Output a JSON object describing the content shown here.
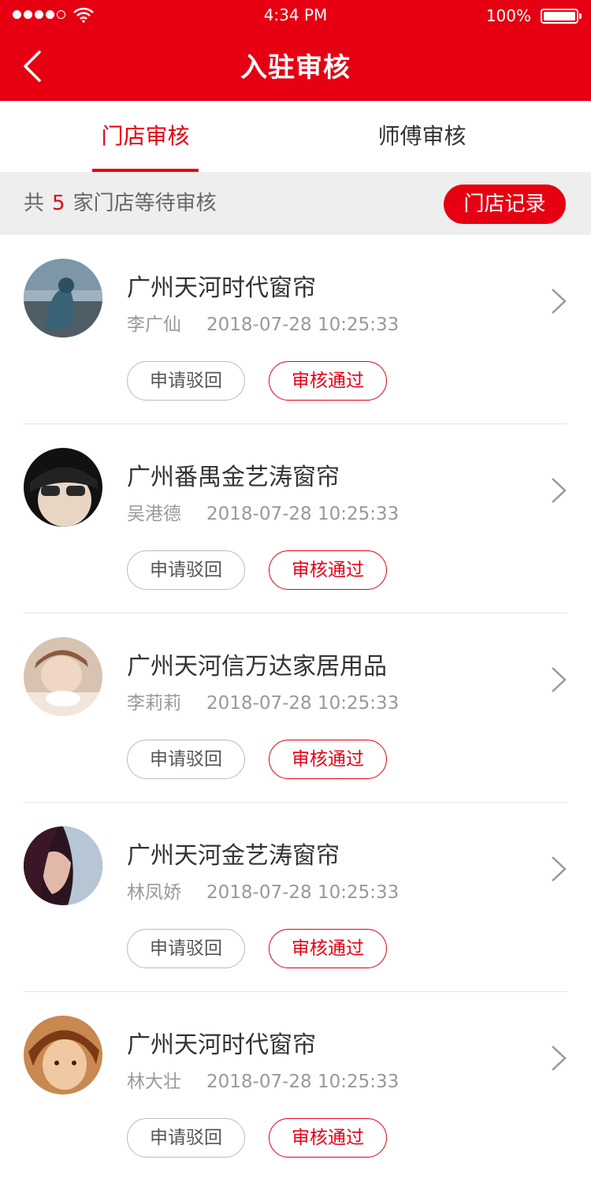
{
  "status_bar": {
    "time": "4:34 PM",
    "battery": "100%"
  },
  "nav": {
    "title": "入驻审核",
    "back_icon": "chevron-left-icon"
  },
  "tabs": [
    {
      "label": "门店审核",
      "active": true
    },
    {
      "label": "师傅审核",
      "active": false
    }
  ],
  "summary": {
    "prefix": "共",
    "count": "5",
    "suffix": "家门店等待审核",
    "record_button": "门店记录"
  },
  "actions": {
    "reject": "申请驳回",
    "approve": "审核通过"
  },
  "stores": [
    {
      "name": "广州天河时代窗帘",
      "applicant": "李广仙",
      "date": "2018-07-28 10:25:33"
    },
    {
      "name": "广州番禺金艺涛窗帘",
      "applicant": "吴港德",
      "date": "2018-07-28 10:25:33"
    },
    {
      "name": "广州天河信万达家居用品",
      "applicant": "李莉莉",
      "date": "2018-07-28 10:25:33"
    },
    {
      "name": "广州天河金艺涛窗帘",
      "applicant": "林凤娇",
      "date": "2018-07-28 10:25:33"
    },
    {
      "name": "广州天河时代窗帘",
      "applicant": "林大壮",
      "date": "2018-07-28 10:25:33"
    }
  ],
  "colors": {
    "accent": "#e60012",
    "divider": "#e5e5e5",
    "summary_bg": "#eeeeee"
  }
}
